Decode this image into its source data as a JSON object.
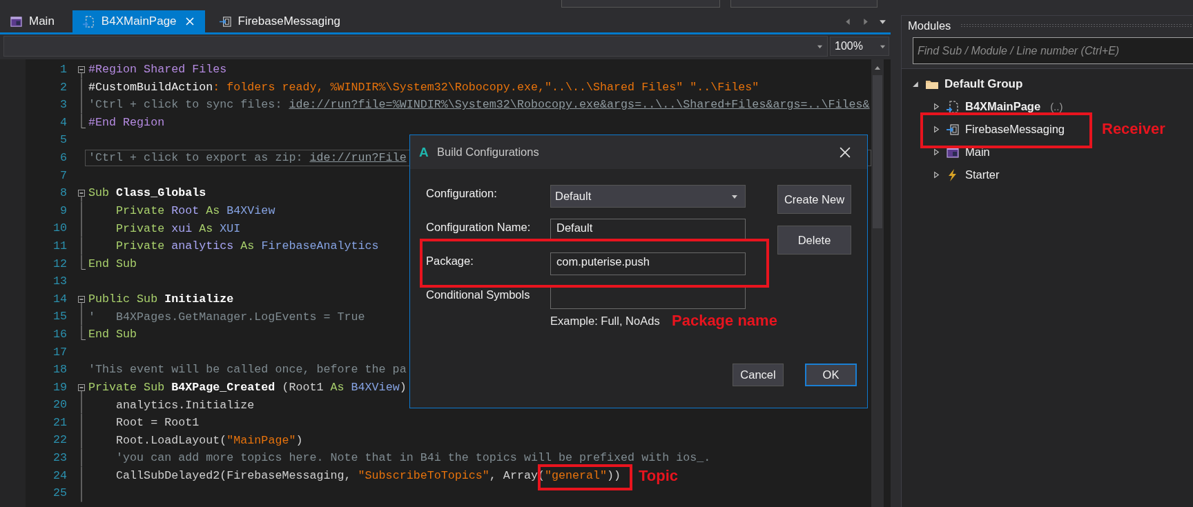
{
  "tabs": [
    {
      "label": "Main",
      "kind": "activity",
      "selected": false
    },
    {
      "label": "B4XMainPage",
      "kind": "class",
      "selected": true
    },
    {
      "label": "FirebaseMessaging",
      "kind": "service",
      "selected": false
    }
  ],
  "zoom": {
    "value": "100%"
  },
  "code": {
    "lines": [
      {
        "n": "1",
        "current": false,
        "expanded": true,
        "open_end": false,
        "tokens": [
          {
            "kind": "directive",
            "text": "#Region Shared Files"
          }
        ],
        "children": [
          {
            "n": "2",
            "current": false,
            "tokens": [
              {
                "kind": "attribute",
                "text": "#CustomBuildAction"
              },
              {
                "kind": "string",
                "text": ": folders ready, %WINDIR%\\System32\\Robocopy.exe,\"..\\..\\Shared Files\" \"..\\Files\""
              }
            ]
          },
          {
            "n": "3",
            "current": false,
            "tokens": [
              {
                "kind": "comment",
                "text": "'Ctrl + click to sync files: "
              },
              {
                "kind": "link",
                "text": "ide://run?file=%WINDIR%\\System32\\Robocopy.exe&args=..\\..\\Shared+Files&args=..\\Files&"
              }
            ]
          },
          {
            "n": "4",
            "current": false,
            "tokens": [
              {
                "kind": "directive",
                "text": "#End Region"
              }
            ]
          }
        ]
      },
      {
        "n": "5",
        "current": false
      },
      {
        "n": "6",
        "current": true,
        "tokens": [
          {
            "kind": "comment",
            "text": "'Ctrl + click to export as zip: "
          },
          {
            "kind": "link",
            "text": "ide://run?File"
          }
        ]
      },
      {
        "n": "7",
        "current": false
      },
      {
        "n": "8",
        "current": false,
        "expanded": true,
        "open_end": false,
        "tokens": [
          {
            "kind": "keyword",
            "text": "Sub "
          },
          {
            "kind": "name",
            "text": "Class_Globals"
          }
        ],
        "children": [
          {
            "n": "9",
            "current": false,
            "tokens": [
              {
                "kind": "keyword",
                "text": "    Private "
              },
              {
                "kind": "variable",
                "text": "Root "
              },
              {
                "kind": "keyword",
                "text": "As "
              },
              {
                "kind": "type",
                "text": "B4XView"
              }
            ]
          },
          {
            "n": "10",
            "current": false,
            "tokens": [
              {
                "kind": "keyword",
                "text": "    Private "
              },
              {
                "kind": "variable",
                "text": "xui "
              },
              {
                "kind": "keyword",
                "text": "As "
              },
              {
                "kind": "type",
                "text": "XUI"
              }
            ]
          },
          {
            "n": "11",
            "current": false,
            "tokens": [
              {
                "kind": "keyword",
                "text": "    Private "
              },
              {
                "kind": "variable",
                "text": "analytics "
              },
              {
                "kind": "keyword",
                "text": "As "
              },
              {
                "kind": "type",
                "text": "FirebaseAnalytics"
              }
            ]
          },
          {
            "n": "12",
            "current": false,
            "tokens": [
              {
                "kind": "keyword",
                "text": "End Sub"
              }
            ]
          }
        ]
      },
      {
        "n": "13",
        "current": false
      },
      {
        "n": "14",
        "current": false,
        "expanded": true,
        "open_end": false,
        "tokens": [
          {
            "kind": "keyword",
            "text": "Public Sub "
          },
          {
            "kind": "name",
            "text": "Initialize"
          }
        ],
        "children": [
          {
            "n": "15",
            "current": false,
            "tokens": [
              {
                "kind": "comment",
                "text": "'   B4XPages.GetManager.LogEvents = True"
              }
            ]
          },
          {
            "n": "16",
            "current": false,
            "tokens": [
              {
                "kind": "keyword",
                "text": "End Sub"
              }
            ]
          }
        ]
      },
      {
        "n": "17",
        "current": false
      },
      {
        "n": "18",
        "current": false,
        "tokens": [
          {
            "kind": "comment",
            "text": "'This event will be called once, before the pa"
          }
        ]
      },
      {
        "n": "19",
        "current": false,
        "expanded": true,
        "open_end": true,
        "tokens": [
          {
            "kind": "keyword",
            "text": "Private Sub "
          },
          {
            "kind": "name",
            "text": "B4XPage_Created"
          },
          {
            "kind": "plain",
            "text": " (Root1 "
          },
          {
            "kind": "keyword",
            "text": "As "
          },
          {
            "kind": "type",
            "text": "B4XView"
          },
          {
            "kind": "plain",
            "text": ")"
          }
        ],
        "children": [
          {
            "n": "20",
            "current": false,
            "tokens": [
              {
                "kind": "plain",
                "text": "    analytics.Initialize"
              }
            ]
          },
          {
            "n": "21",
            "current": false,
            "tokens": [
              {
                "kind": "plain",
                "text": "    Root = Root1"
              }
            ]
          },
          {
            "n": "22",
            "current": false,
            "tokens": [
              {
                "kind": "plain",
                "text": "    Root.LoadLayout("
              },
              {
                "kind": "string",
                "text": "\"MainPage\""
              },
              {
                "kind": "plain",
                "text": ")"
              }
            ]
          },
          {
            "n": "23",
            "current": false,
            "tokens": [
              {
                "kind": "comment",
                "text": "    'you can add more topics here. Note that in B4i the topics will be prefixed with ios_."
              }
            ]
          },
          {
            "n": "24",
            "current": false,
            "tokens": [
              {
                "kind": "plain",
                "text": "    CallSubDelayed2(FirebaseMessaging, "
              },
              {
                "kind": "string",
                "text": "\"SubscribeToTopics\""
              },
              {
                "kind": "plain",
                "text": ", Array("
              },
              {
                "kind": "string",
                "text": "\"general\""
              },
              {
                "kind": "plain",
                "text": "))"
              }
            ]
          },
          {
            "n": "25",
            "current": false
          }
        ]
      }
    ]
  },
  "dialog": {
    "logo": "A",
    "title": "Build Configurations",
    "fields": [
      {
        "label": "Configuration:",
        "kind": "dropdown",
        "value": "Default"
      },
      {
        "label": "Configuration Name:",
        "kind": "text",
        "value": "Default"
      },
      {
        "label": "Package:",
        "kind": "text",
        "value": "com.puterise.push"
      },
      {
        "label": "Conditional Symbols",
        "kind": "text"
      }
    ],
    "hint": "Example: Full, NoAds",
    "side_buttons": [
      "Create New",
      "Delete"
    ],
    "buttons": [
      {
        "label": "Cancel",
        "default": false
      },
      {
        "label": "OK",
        "default": true
      }
    ]
  },
  "modules": {
    "title": "Modules",
    "search": {
      "placeholder": "Find Sub / Module / Line number (Ctrl+E)"
    },
    "tree": [
      {
        "label": "Default Group",
        "expanded": true,
        "children": [
          {
            "label": "B4XMainPage",
            "kind": "class",
            "bold": true,
            "suffix": "(..)",
            "expanded": false
          },
          {
            "label": "FirebaseMessaging",
            "kind": "service",
            "bold": false,
            "expanded": false
          },
          {
            "label": "Main",
            "kind": "activity",
            "bold": false,
            "expanded": false
          },
          {
            "label": "Starter",
            "kind": "starter",
            "bold": false,
            "expanded": false
          }
        ]
      }
    ]
  },
  "annotations": [
    {
      "label": "Receiver"
    },
    {
      "label": "Package name"
    },
    {
      "label": "Topic"
    }
  ]
}
